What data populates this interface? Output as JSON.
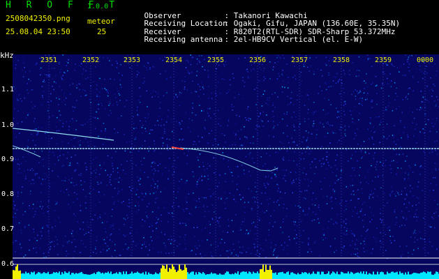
{
  "header": {
    "brand": "H R O F F T",
    "version": "1.0.0",
    "filename": "2508042350.png",
    "meteor_label": "meteor",
    "datetime": "25.08.04 23:50",
    "meteor_count": "25"
  },
  "info": [
    {
      "key": "Observer",
      "value": ": Takanori Kawachi"
    },
    {
      "key": "Receiving Location",
      "value": ": Ogaki, Gifu, JAPAN (136.60E, 35.35N)"
    },
    {
      "key": "Receiver",
      "value": ": R820T2(RTL-SDR) SDR-Sharp 53.372MHz"
    },
    {
      "key": "Receiving antenna",
      "value": ": 2el-HB9CV Vertical (el. E-W)"
    }
  ],
  "chart_data": {
    "type": "heatmap",
    "ylabel": "kHz",
    "y_ticks": [
      "1.1",
      "1.0",
      "0.9",
      "0.8",
      "0.7",
      "0.6"
    ],
    "x_ticks": [
      "2351",
      "2352",
      "2353",
      "2354",
      "2355",
      "2356",
      "2357",
      "2358",
      "2359",
      "0000"
    ],
    "carrier_khz": 0.935,
    "colors": {
      "background": "#06065e",
      "carrier": "#b8ffff",
      "grid": "#ffffff",
      "tick_x": "#f0f000",
      "activity": "#00e8ff",
      "activity_peak": "#f0f000"
    }
  }
}
